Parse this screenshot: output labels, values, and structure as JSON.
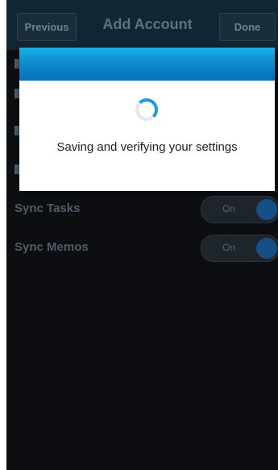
{
  "titlebar": {
    "previous_label": "Previous",
    "title": "Add Account",
    "done_label": "Done"
  },
  "rows": [
    {
      "label": "Sync Tasks",
      "toggle_label": "On"
    },
    {
      "label": "Sync Memos",
      "toggle_label": "On"
    }
  ],
  "dialog": {
    "message": "Saving and verifying your settings"
  },
  "colors": {
    "accent": "#0b82c9",
    "toggle_knob": "#164f86"
  },
  "icons": [
    "progress-spinner-icon"
  ]
}
